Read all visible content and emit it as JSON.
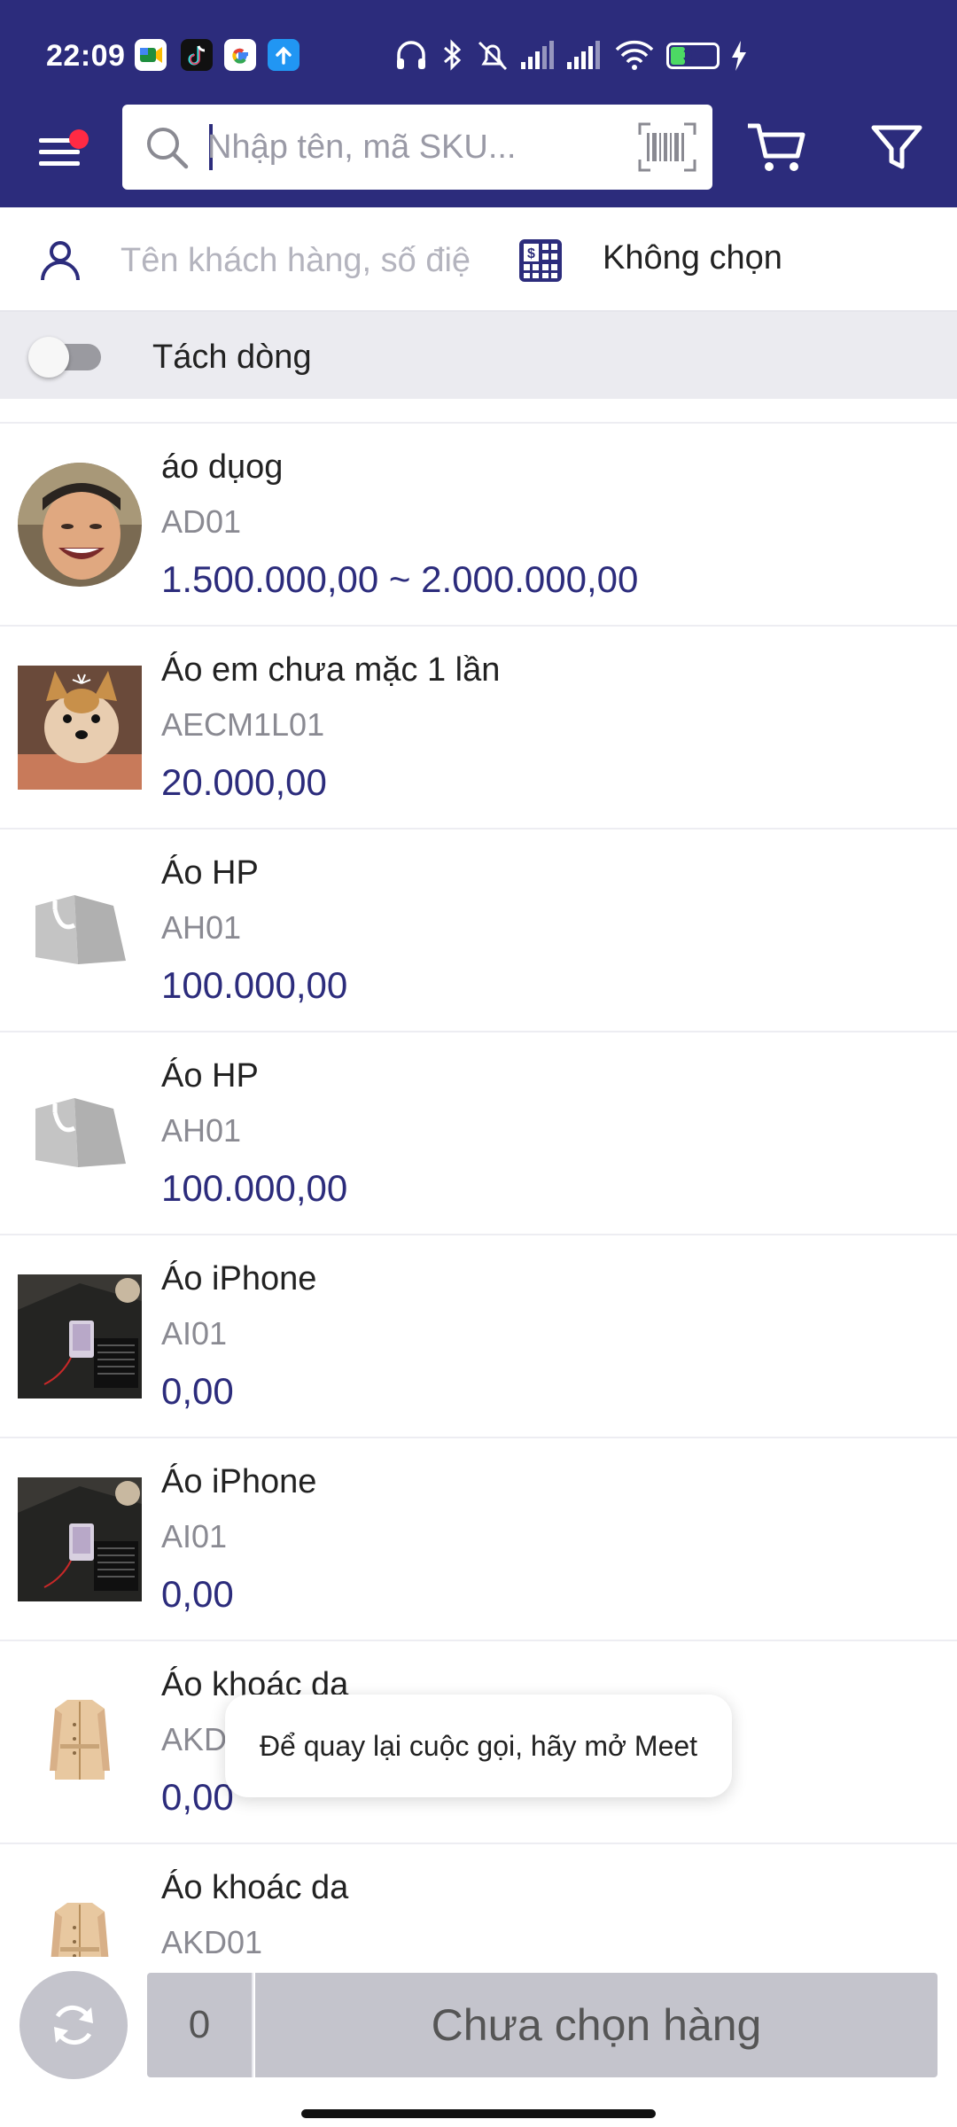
{
  "status_bar": {
    "time": "22:09",
    "apps": [
      "google-meet-icon",
      "tiktok-icon",
      "google-icon",
      "upload-icon"
    ],
    "battery_level": "31",
    "battery_percent": 31
  },
  "header": {
    "search_placeholder": "Nhập tên, mã SKU...",
    "has_notification": true
  },
  "customer": {
    "placeholder": "Tên khách hàng, số điện thoại",
    "pricebook_label": "Không chọn"
  },
  "split": {
    "label": "Tách dòng",
    "enabled": false
  },
  "products": [
    {
      "name": "áo dụog",
      "sku": "AD01",
      "price": "1.500.000,00 ~ 2.000.000,00",
      "thumb": "avatar-photo"
    },
    {
      "name": "Áo em chưa mặc 1 lần",
      "sku": "AECM1L01",
      "price": "20.000,00",
      "thumb": "dog-photo"
    },
    {
      "name": "Áo HP",
      "sku": "AH01",
      "price": "100.000,00",
      "thumb": "shopping-bag-placeholder"
    },
    {
      "name": "Áo HP",
      "sku": "AH01",
      "price": "100.000,00",
      "thumb": "shopping-bag-placeholder"
    },
    {
      "name": "Áo iPhone",
      "sku": "AI01",
      "price": "0,00",
      "thumb": "desk-photo"
    },
    {
      "name": "Áo iPhone",
      "sku": "AI01",
      "price": "0,00",
      "thumb": "desk-photo"
    },
    {
      "name": "Áo khoác da",
      "sku": "AKD01",
      "price": "0,00",
      "thumb": "coat-image"
    },
    {
      "name": "Áo khoác da",
      "sku": "AKD01",
      "price": "",
      "thumb": "coat-image"
    }
  ],
  "toast": {
    "text": "Để quay lại cuộc gọi, hãy mở Meet"
  },
  "bottom": {
    "count": "0",
    "checkout_label": "Chưa chọn hàng"
  },
  "colors": {
    "brand": "#2c2c7c",
    "price": "#2c2c7c",
    "disabled": "#c4c4cc",
    "notification": "#ff2a44"
  }
}
